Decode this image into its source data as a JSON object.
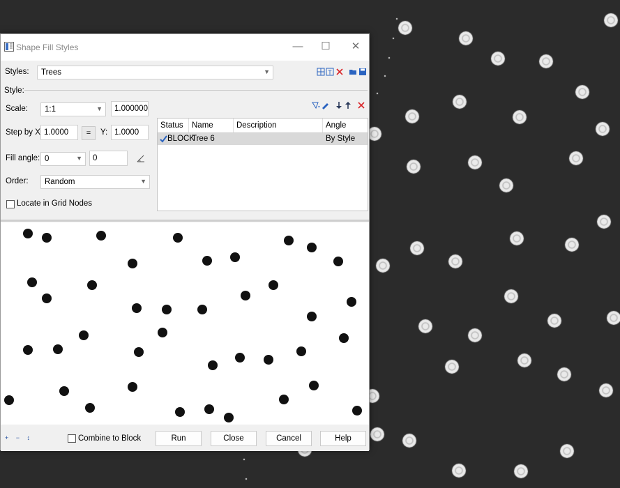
{
  "window": {
    "title": "Shape Fill Styles"
  },
  "styles_row": {
    "label": "Styles:",
    "value": "Trees"
  },
  "style_group": {
    "label": "Style:"
  },
  "scale": {
    "label": "Scale:",
    "select_value": "1:1",
    "input_value": "1.000000"
  },
  "step": {
    "label": "Step by X:",
    "x_value": "1.0000",
    "equal_button": "=",
    "y_label": "Y:",
    "y_value": "1.0000"
  },
  "fill_angle": {
    "label": "Fill angle:",
    "select_value": "0",
    "input_value": "0"
  },
  "order": {
    "label": "Order:",
    "value": "Random"
  },
  "locate_grid": {
    "label": "Locate in Grid Nodes",
    "checked": false
  },
  "table": {
    "columns": [
      "Status",
      "Name",
      "Description",
      "Angle"
    ],
    "rows": [
      {
        "status": "BLOCK",
        "name": "Tree 6",
        "description": "",
        "angle": "By Style"
      }
    ]
  },
  "footer": {
    "combine_label": "Combine to Block",
    "run": "Run",
    "close": "Close",
    "cancel": "Cancel",
    "help": "Help"
  },
  "colors": {
    "desktop_bg": "#2b2b2b",
    "accent_blue": "#2a63c0",
    "delete_red": "#d9262a"
  }
}
